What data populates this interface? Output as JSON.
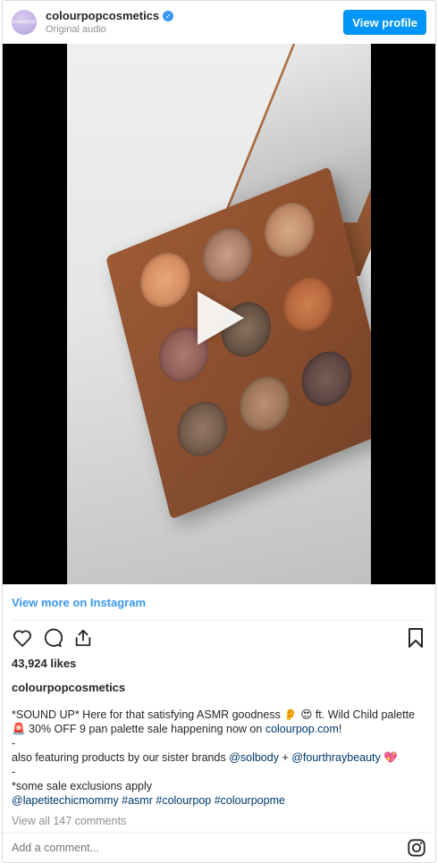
{
  "header": {
    "avatar_text": "colourpop",
    "username": "colourpopcosmetics",
    "subtitle": "Original audio",
    "view_profile_label": "View profile"
  },
  "media": {
    "type": "video",
    "state": "paused"
  },
  "footer": {
    "view_more_label": "View more on Instagram",
    "likes": "43,924 likes",
    "caption_username": "colourpopcosmetics",
    "caption_lines": {
      "l1": "*SOUND UP* Here for that satisfying ASMR goodness 👂 😍 ft. Wild Child palette",
      "l2a": "🚨 30% OFF 9 pan palette sale happening now on ",
      "l2b": "colourpop.com",
      "l2c": "!",
      "l3": "-",
      "l4a": "also featuring products by our sister brands ",
      "l4b": "@solbody",
      "l4c": " + ",
      "l4d": "@fourthraybeauty",
      "l4e": " 💖",
      "l5": "-",
      "l6": "*some sale exclusions apply",
      "l7a": "@lapetitechicmommy",
      "l7b": " ",
      "l7c": "#asmr",
      "l7d": " ",
      "l7e": "#colourpop",
      "l7f": " ",
      "l7g": "#colourpopme"
    },
    "view_all_comments": "View all 147 comments",
    "comment_placeholder": "Add a comment..."
  },
  "icons": {
    "like": "heart-icon",
    "comment": "comment-icon",
    "share": "share-icon",
    "save": "bookmark-icon",
    "instagram": "instagram-icon",
    "verified": "verified-badge-icon",
    "play": "play-icon"
  },
  "colors": {
    "accent": "#0095f6",
    "link": "#3897f0",
    "text": "#262626",
    "muted": "#8e8e8e"
  }
}
